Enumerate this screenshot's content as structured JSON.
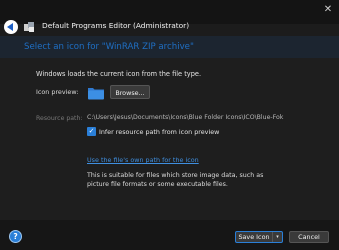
{
  "window": {
    "title": "Default Programs Editor (Administrator)",
    "close_glyph": "✕"
  },
  "header": {
    "heading": "Select an icon for \"WinRAR ZIP archive\""
  },
  "content": {
    "description": "Windows loads the current icon from the file type.",
    "icon_preview_label": "Icon preview:",
    "browse_label": "Browse...",
    "resource_path_label": "Resource path:",
    "resource_path_value": "C:\\Users\\Jesus\\Documents\\Icons\\Blue Folder Icons\\ICO\\Blue-Fok",
    "infer_checkbox_label": "Infer resource path from icon preview",
    "infer_checked": true,
    "own_path_link": "Use the file's own path for the icon",
    "own_path_info": "This is suitable for files which store image data, such as picture file formats or some executable files."
  },
  "footer": {
    "help_glyph": "?",
    "save_label": "Save Icon",
    "save_dropdown_glyph": "▾",
    "cancel_label": "Cancel"
  },
  "colors": {
    "accent": "#2a7fd8",
    "heading": "#1f6fc4",
    "link": "#3f8fe0",
    "background": "#1e1e1e"
  },
  "icons": {
    "back": "back-arrow-icon",
    "app": "app-icon",
    "folder": "folder-icon",
    "help": "help-icon",
    "close": "close-icon"
  }
}
